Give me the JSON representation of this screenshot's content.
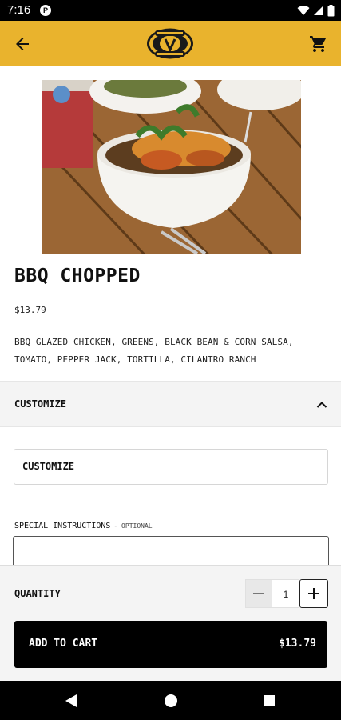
{
  "status_bar": {
    "time": "7:16",
    "notification_icon": "p-circle-icon",
    "icons": [
      "wifi-icon",
      "signal-icon",
      "battery-icon"
    ]
  },
  "app_bar": {
    "back_icon": "arrow-left-icon",
    "logo": "restaurant-logo",
    "cart_icon": "cart-icon",
    "accent_color": "#e9b32d"
  },
  "product": {
    "image": "food-bowl-photo",
    "title": "BBQ CHOPPED",
    "price": "$13.79",
    "description": "BBQ GLAZED CHICKEN, GREENS, BLACK BEAN & CORN SALSA, TOMATO, PEPPER JACK, TORTILLA, CILANTRO RANCH"
  },
  "customize_section": {
    "header": "CUSTOMIZE",
    "expanded": true,
    "option_label": "CUSTOMIZE"
  },
  "special_instructions": {
    "label": "SPECIAL INSTRUCTIONS",
    "optional_label": "- OPTIONAL",
    "value": ""
  },
  "quantity": {
    "label": "QUANTITY",
    "value": "1"
  },
  "add_to_cart": {
    "label": "ADD TO CART",
    "amount": "$13.79"
  },
  "nav_bar": {
    "icons": [
      "back-triangle-icon",
      "home-circle-icon",
      "recents-square-icon"
    ]
  }
}
